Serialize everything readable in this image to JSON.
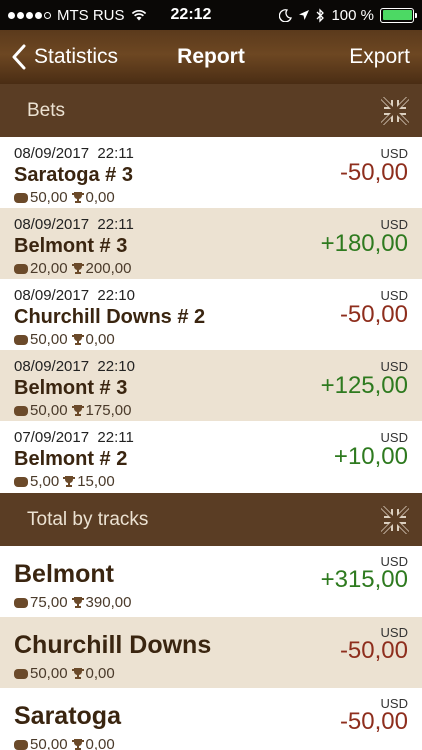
{
  "status_bar": {
    "carrier": "MTS RUS",
    "time": "22:12",
    "battery": "100 %",
    "battery_level": 1.0
  },
  "nav": {
    "back_label": "Statistics",
    "title": "Report",
    "export_label": "Export"
  },
  "sections": {
    "bets": "Bets",
    "totals": "Total by tracks"
  },
  "bets": [
    {
      "date": "08/09/2017",
      "time": "22:11",
      "track": "Saratoga # 3",
      "stake": "50,00",
      "win": "0,00",
      "currency": "USD",
      "amount": "-50,00"
    },
    {
      "date": "08/09/2017",
      "time": "22:11",
      "track": "Belmont # 3",
      "stake": "20,00",
      "win": "200,00",
      "currency": "USD",
      "amount": "+180,00"
    },
    {
      "date": "08/09/2017",
      "time": "22:10",
      "track": "Churchill Downs # 2",
      "stake": "50,00",
      "win": "0,00",
      "currency": "USD",
      "amount": "-50,00"
    },
    {
      "date": "08/09/2017",
      "time": "22:10",
      "track": "Belmont # 3",
      "stake": "50,00",
      "win": "175,00",
      "currency": "USD",
      "amount": "+125,00"
    },
    {
      "date": "07/09/2017",
      "time": "22:11",
      "track": "Belmont # 2",
      "stake": "5,00",
      "win": "15,00",
      "currency": "USD",
      "amount": "+10,00"
    }
  ],
  "totals": [
    {
      "track": "Belmont",
      "stake": "75,00",
      "win": "390,00",
      "currency": "USD",
      "amount": "+315,00"
    },
    {
      "track": "Churchill Downs",
      "stake": "50,00",
      "win": "0,00",
      "currency": "USD",
      "amount": "-50,00"
    },
    {
      "track": "Saratoga",
      "stake": "50,00",
      "win": "0,00",
      "currency": "USD",
      "amount": "-50,00"
    }
  ],
  "colors": {
    "negative": "#8e2e1d",
    "positive": "#2e7a1f",
    "header_bg": "#5a3d24",
    "alt_row_bg": "#ece2d2"
  },
  "icons": {
    "stake": "chip-icon",
    "win": "trophy-icon",
    "collapse": "collapse-arrows-icon",
    "back": "chevron-left-icon"
  }
}
